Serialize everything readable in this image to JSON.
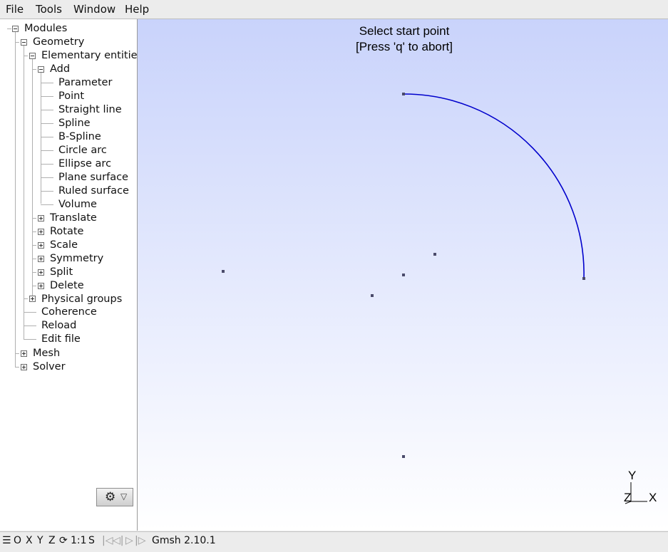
{
  "menu": [
    "File",
    "Tools",
    "Window",
    "Help"
  ],
  "tree": {
    "root": "Modules",
    "geometry": "Geometry",
    "elementary": "Elementary entities",
    "add": "Add",
    "add_items": [
      "Parameter",
      "Point",
      "Straight line",
      "Spline",
      "B-Spline",
      "Circle arc",
      "Ellipse arc",
      "Plane surface",
      "Ruled surface",
      "Volume"
    ],
    "elementary_items": [
      "Translate",
      "Rotate",
      "Scale",
      "Symmetry",
      "Split",
      "Delete"
    ],
    "geometry_items": [
      "Physical groups",
      "Coherence",
      "Reload",
      "Edit file"
    ],
    "mesh": "Mesh",
    "solver": "Solver"
  },
  "graphics": {
    "message_line1": "Select start point",
    "message_line2": "[Press 'q' to abort]",
    "axis_labels": {
      "y": "Y",
      "z": "Z",
      "x": "X"
    },
    "arc_color": "#0000cc",
    "point_color": "#4a4a6a"
  },
  "statusbar": {
    "menu_icon": "☰",
    "o": "O",
    "x": "X",
    "y": "Y",
    "z": "Z",
    "rotate_icon": "⟳",
    "scale": "1:1",
    "s": "S",
    "first_icon": "|◁",
    "prev_icon": "◁|",
    "play_icon": "▷",
    "next_icon": "|▷",
    "version": "Gmsh 2.10.1"
  }
}
